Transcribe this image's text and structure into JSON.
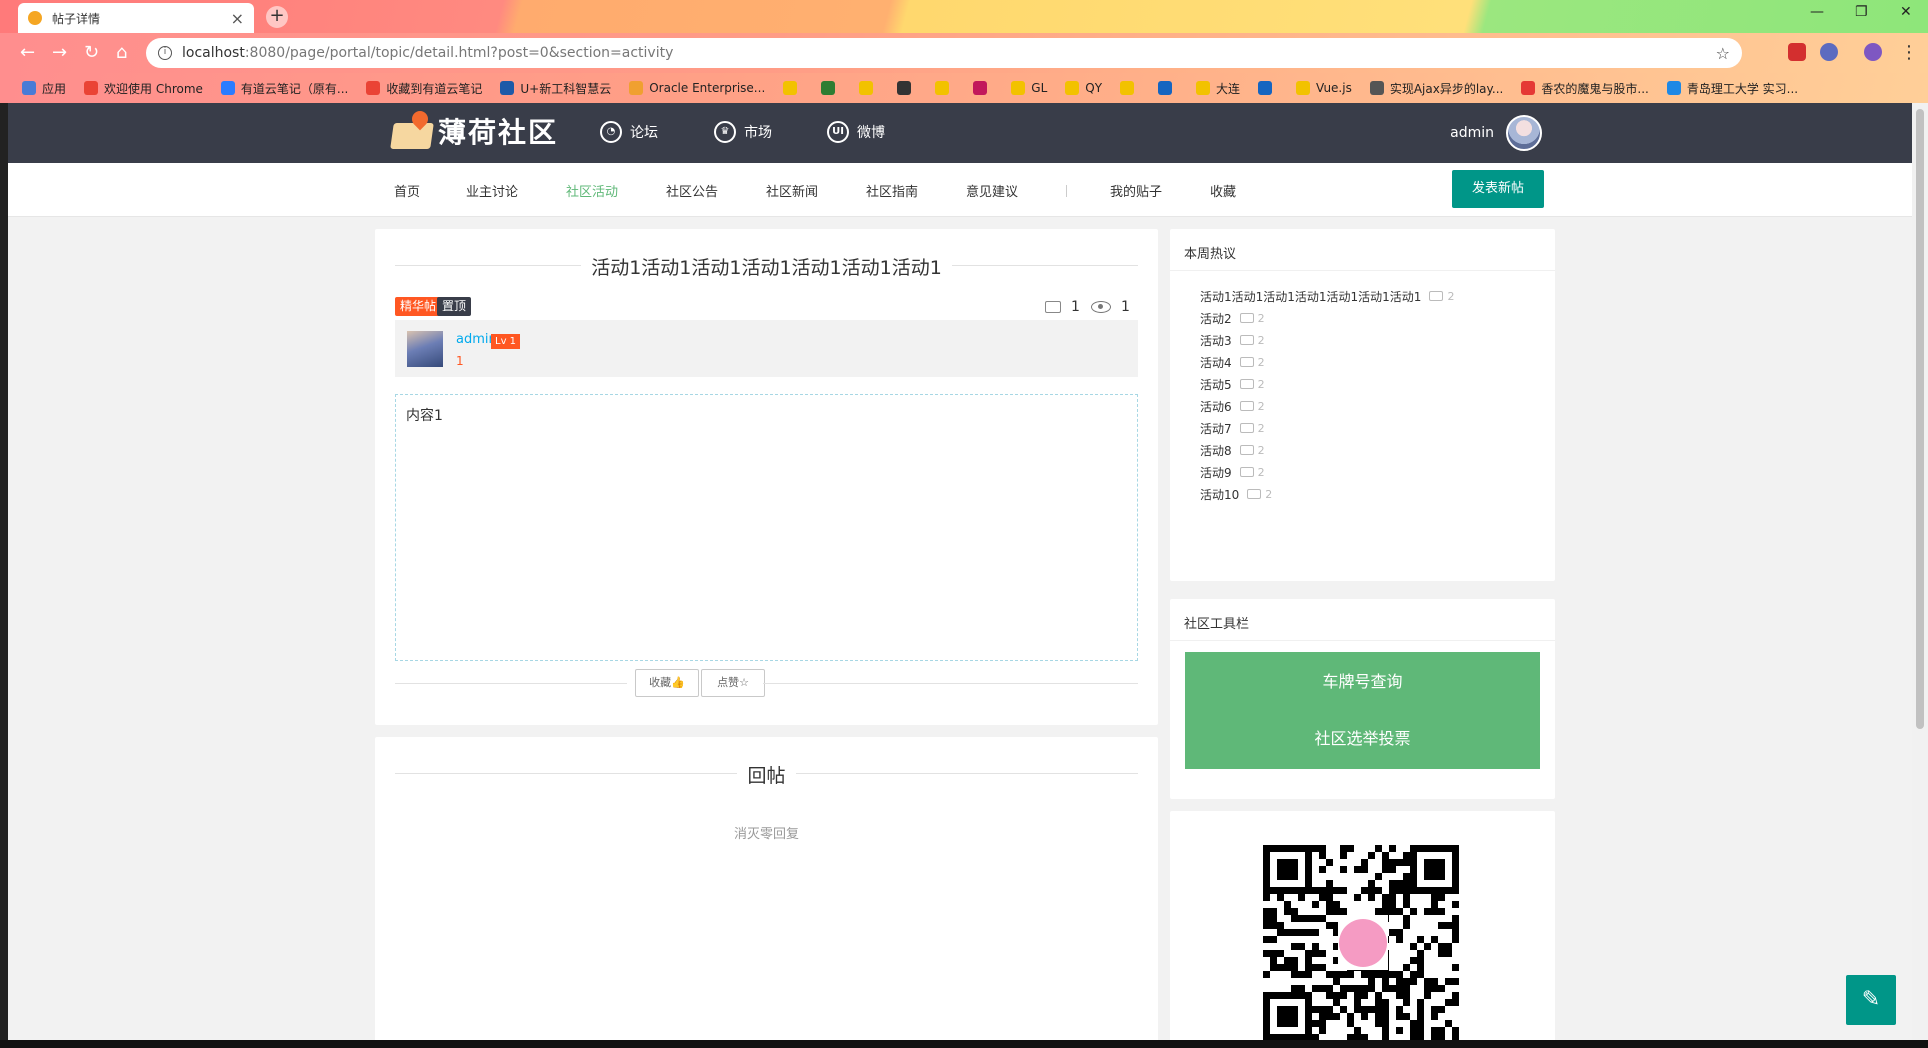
{
  "browser": {
    "tab_title": "帖子详情",
    "url_host": "localhost",
    "url_rest": ":8080/page/portal/topic/detail.html?post=0&section=activity",
    "bookmarks": [
      {
        "label": "应用",
        "color": "#4a7bd6"
      },
      {
        "label": "欢迎使用 Chrome",
        "color": "#ea4335"
      },
      {
        "label": "有道云笔记（原有...",
        "color": "#2b7cff"
      },
      {
        "label": "收藏到有道云笔记",
        "color": "#ea4335"
      },
      {
        "label": "U+新工科智慧云",
        "color": "#1e5aa8"
      },
      {
        "label": "Oracle Enterprise...",
        "color": "#f0a030"
      },
      {
        "label": "",
        "color": "#f2c200"
      },
      {
        "label": "",
        "color": "#2e7d32"
      },
      {
        "label": "",
        "color": "#f2c200"
      },
      {
        "label": "",
        "color": "#333333"
      },
      {
        "label": "",
        "color": "#f2c200"
      },
      {
        "label": "",
        "color": "#c2185b"
      },
      {
        "label": "GL",
        "color": "#f2c200"
      },
      {
        "label": "QY",
        "color": "#f2c200"
      },
      {
        "label": "",
        "color": "#f2c200"
      },
      {
        "label": "",
        "color": "#1565c0"
      },
      {
        "label": "大连",
        "color": "#f2c200"
      },
      {
        "label": "",
        "color": "#1565c0"
      },
      {
        "label": "Vue.js",
        "color": "#f2c200"
      },
      {
        "label": "实现Ajax异步的lay...",
        "color": "#555555"
      },
      {
        "label": "香农的魔鬼与股市...",
        "color": "#e53935"
      },
      {
        "label": "青岛理工大学 实习...",
        "color": "#1e88e5"
      }
    ]
  },
  "site": {
    "name": "薄荷社区",
    "top_links": [
      {
        "label": "论坛",
        "icon": "forum-icon"
      },
      {
        "label": "市场",
        "icon": "market-icon"
      },
      {
        "label": "微博",
        "icon": "weibo-icon"
      }
    ],
    "username": "admin",
    "sub_links": [
      "首页",
      "业主讨论",
      "社区活动",
      "社区公告",
      "社区新闻",
      "社区指南",
      "意见建议"
    ],
    "sub_links_right": [
      "我的贴子",
      "收藏"
    ],
    "active_sub": "社区活动",
    "post_button": "发表新帖"
  },
  "post": {
    "title": "活动1活动1活动1活动1活动1活动1活动1",
    "badges": [
      "精华帖",
      "置顶"
    ],
    "comment_count": "1",
    "view_count": "1",
    "author": "admin",
    "level": "Lv 1",
    "rank": "1",
    "content": "内容1",
    "favorite_label": "收藏",
    "like_label": "点赞"
  },
  "reply": {
    "title": "回帖",
    "empty_text": "消灭零回复"
  },
  "hot": {
    "title": "本周热议",
    "items": [
      {
        "label": "活动1活动1活动1活动1活动1活动1活动1",
        "count": "2"
      },
      {
        "label": "活动2",
        "count": "2"
      },
      {
        "label": "活动3",
        "count": "2"
      },
      {
        "label": "活动4",
        "count": "2"
      },
      {
        "label": "活动5",
        "count": "2"
      },
      {
        "label": "活动6",
        "count": "2"
      },
      {
        "label": "活动7",
        "count": "2"
      },
      {
        "label": "活动8",
        "count": "2"
      },
      {
        "label": "活动9",
        "count": "2"
      },
      {
        "label": "活动10",
        "count": "2"
      }
    ]
  },
  "tools": {
    "title": "社区工具栏",
    "buttons": [
      "车牌号查询",
      "社区选举投票"
    ]
  },
  "colors": {
    "topnav": "#393d49",
    "accent": "#009688",
    "green": "#5fb878",
    "badge_hot": "#ff5722",
    "badge_top": "#393d49"
  }
}
